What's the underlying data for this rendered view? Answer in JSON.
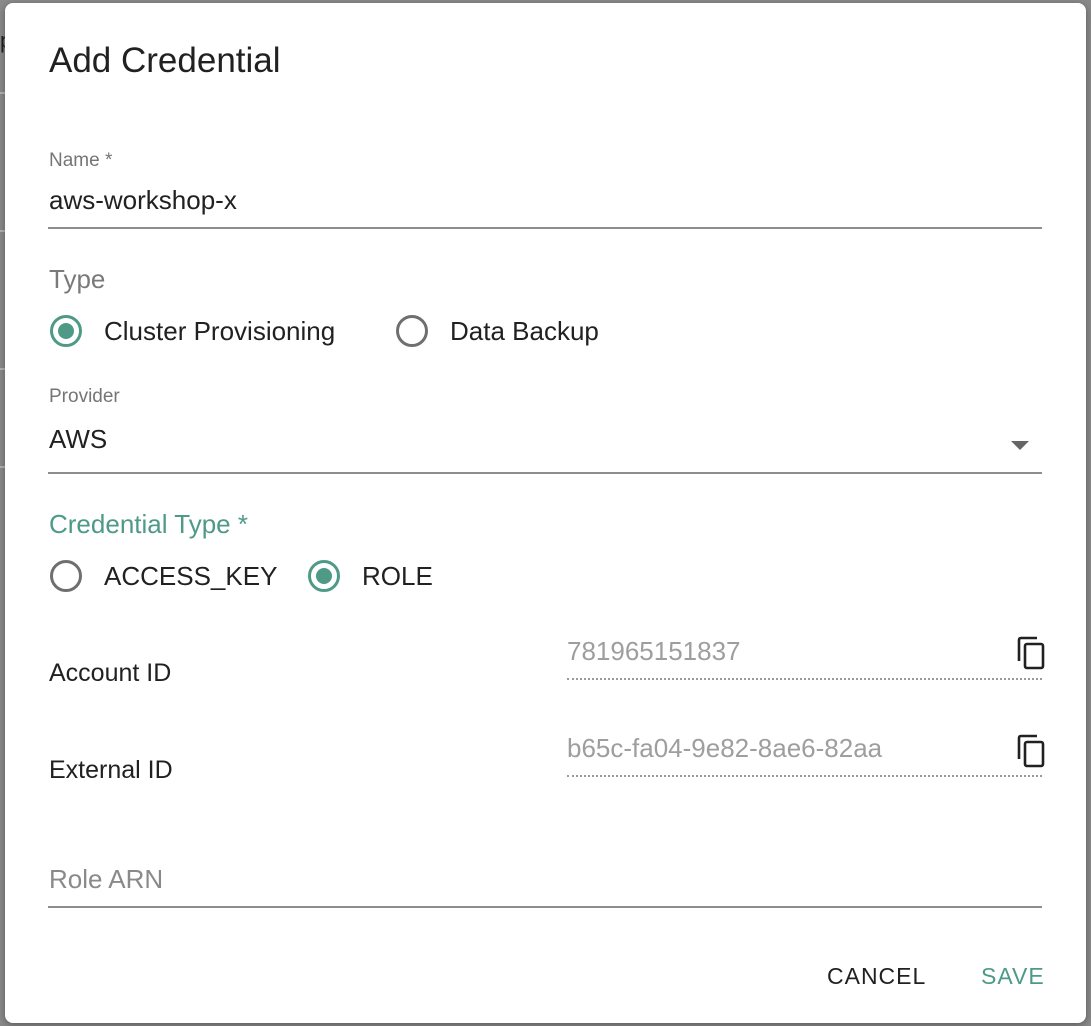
{
  "background": {
    "partial_glyph": "p"
  },
  "dialog": {
    "title": "Add Credential",
    "name_field": {
      "label": "Name *",
      "value": "aws-workshop-x"
    },
    "type": {
      "label": "Type",
      "options": [
        {
          "label": "Cluster Provisioning",
          "selected": true
        },
        {
          "label": "Data Backup",
          "selected": false
        }
      ]
    },
    "provider": {
      "label": "Provider",
      "value": "AWS"
    },
    "credential_type": {
      "label": "Credential Type *",
      "options": [
        {
          "label": "ACCESS_KEY",
          "selected": false
        },
        {
          "label": "ROLE",
          "selected": true
        }
      ]
    },
    "account_id": {
      "label": "Account ID",
      "value": "781965151837",
      "icon": "copy-icon"
    },
    "external_id": {
      "label": "External ID",
      "value": "b65c-fa04-9e82-8ae6-82aa",
      "icon": "copy-icon"
    },
    "role_arn": {
      "placeholder": "Role ARN",
      "value": ""
    },
    "actions": {
      "cancel_label": "CANCEL",
      "save_label": "SAVE"
    }
  },
  "colors": {
    "accent": "#4e9a87",
    "backdrop": "#8a8a8a"
  }
}
